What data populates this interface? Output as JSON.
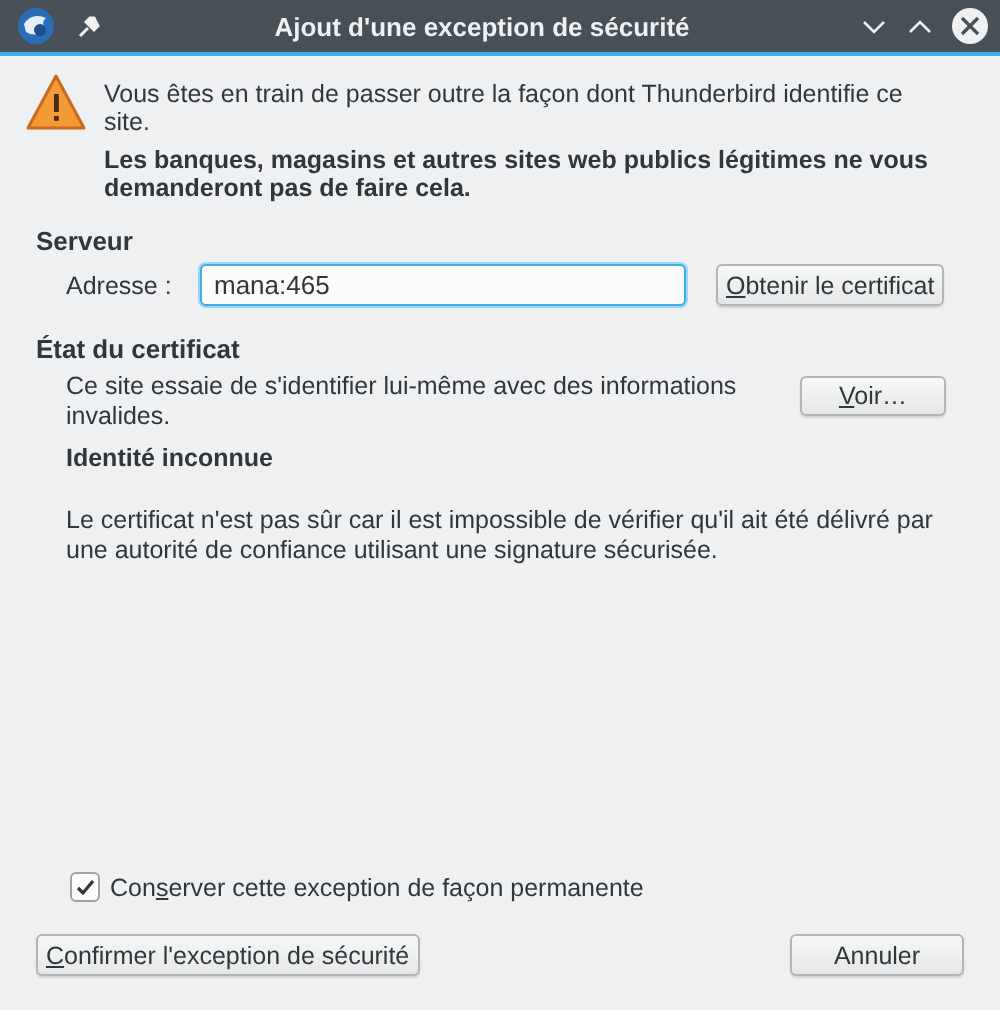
{
  "window": {
    "title": "Ajout d'une exception de sécurité"
  },
  "warning": {
    "text": "Vous êtes en train de passer outre la façon dont Thunderbird identifie ce site.",
    "emphasis": "Les banques, magasins et autres sites web publics légitimes ne vous demanderont pas de faire cela."
  },
  "server": {
    "heading": "Serveur",
    "address_label": "Adresse :",
    "address_value": "mana:465",
    "fetch_button": {
      "key": "O",
      "after": "btenir le certificat"
    }
  },
  "status": {
    "heading": "État du certificat",
    "message": "Ce site essaie de s'identifier lui-même avec des informations invalides.",
    "view_button": {
      "key": "V",
      "after": "oir…"
    },
    "problem_title": "Identité inconnue",
    "problem_text": "Le certificat n'est pas sûr car il est impossible de vérifier qu'il ait été délivré par une autorité de confiance utilisant une signature sécurisée."
  },
  "permanent": {
    "label": {
      "before": "Con",
      "key": "s",
      "after": "erver cette exception de façon permanente"
    },
    "checked": true
  },
  "buttons": [
    {
      "kind": "confirm",
      "label": {
        "key": "C",
        "after": "onfirmer l'exception de sécurité"
      }
    },
    {
      "kind": "cancel",
      "label": {
        "before": "Annuler"
      }
    }
  ]
}
